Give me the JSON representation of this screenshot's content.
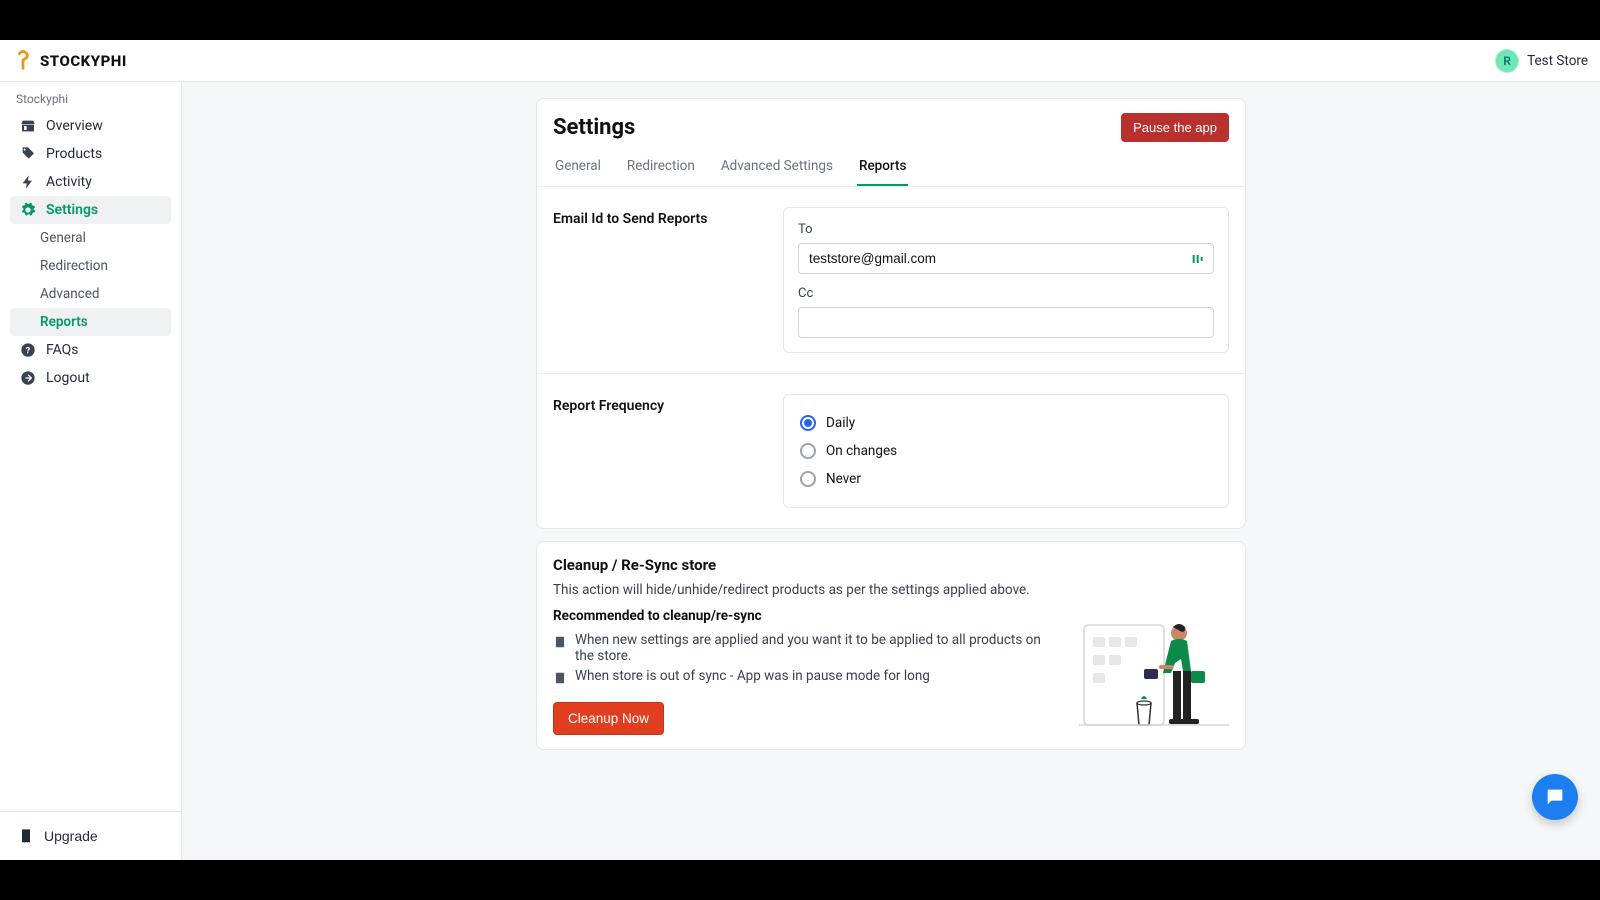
{
  "brand": {
    "name": "STOCKYPHI"
  },
  "store": {
    "avatar_letter": "R",
    "name": "Test Store"
  },
  "sidebar": {
    "heading": "Stockyphi",
    "items": [
      "Overview",
      "Products",
      "Activity",
      "Settings"
    ],
    "sub_items": [
      "General",
      "Redirection",
      "Advanced",
      "Reports"
    ],
    "faqs": "FAQs",
    "logout": "Logout",
    "upgrade": "Upgrade"
  },
  "page": {
    "title": "Settings",
    "pause_btn": "Pause the app"
  },
  "tabs": [
    "General",
    "Redirection",
    "Advanced Settings",
    "Reports"
  ],
  "email_section": {
    "label": "Email Id to Send Reports",
    "to_label": "To",
    "to_value": "teststore@gmail.com",
    "cc_label": "Cc",
    "cc_value": ""
  },
  "freq_section": {
    "label": "Report Frequency",
    "options": [
      "Daily",
      "On changes",
      "Never"
    ]
  },
  "cleanup": {
    "title": "Cleanup / Re-Sync store",
    "desc": "This action will hide/unhide/redirect products as per the settings applied above.",
    "sub": "Recommended to cleanup/re-sync",
    "bullets": [
      "When new settings are applied and you want it to be applied to all products on the store.",
      "When store is out of sync - App was in pause mode for long"
    ],
    "button": "Cleanup Now"
  }
}
